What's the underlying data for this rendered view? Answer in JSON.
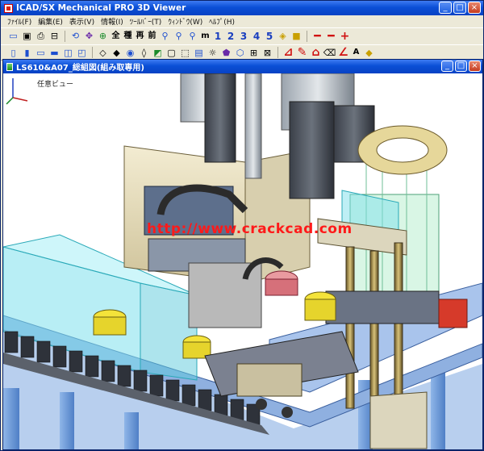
{
  "app": {
    "title": "ICAD/SX Mechanical PRO 3D Viewer",
    "accent": "#0a4fd6"
  },
  "window_controls": {
    "minimize": "_",
    "maximize": "□",
    "close": "×"
  },
  "menu": [
    {
      "label": "ﾌｧｲﾙ(F)"
    },
    {
      "label": "編集(E)"
    },
    {
      "label": "表示(V)"
    },
    {
      "label": "情報(I)"
    },
    {
      "label": "ﾂｰﾙﾊﾞｰ(T)"
    },
    {
      "label": "ｳｨﾝﾄﾞｳ(W)"
    },
    {
      "label": "ﾍﾙﾌﾟ(H)"
    }
  ],
  "toolbar_text": {
    "all": "全",
    "fit": "種",
    "regen": "再",
    "front": "前",
    "m": "m",
    "a": "A",
    "num1": "1",
    "num2": "2",
    "num3": "3",
    "num4": "4",
    "num5": "5"
  },
  "document": {
    "title": "LS610&A07_総組図(組み取専用)"
  },
  "viewport": {
    "view_label": "任意ビュー",
    "watermark": "http://www.crackcad.com"
  }
}
